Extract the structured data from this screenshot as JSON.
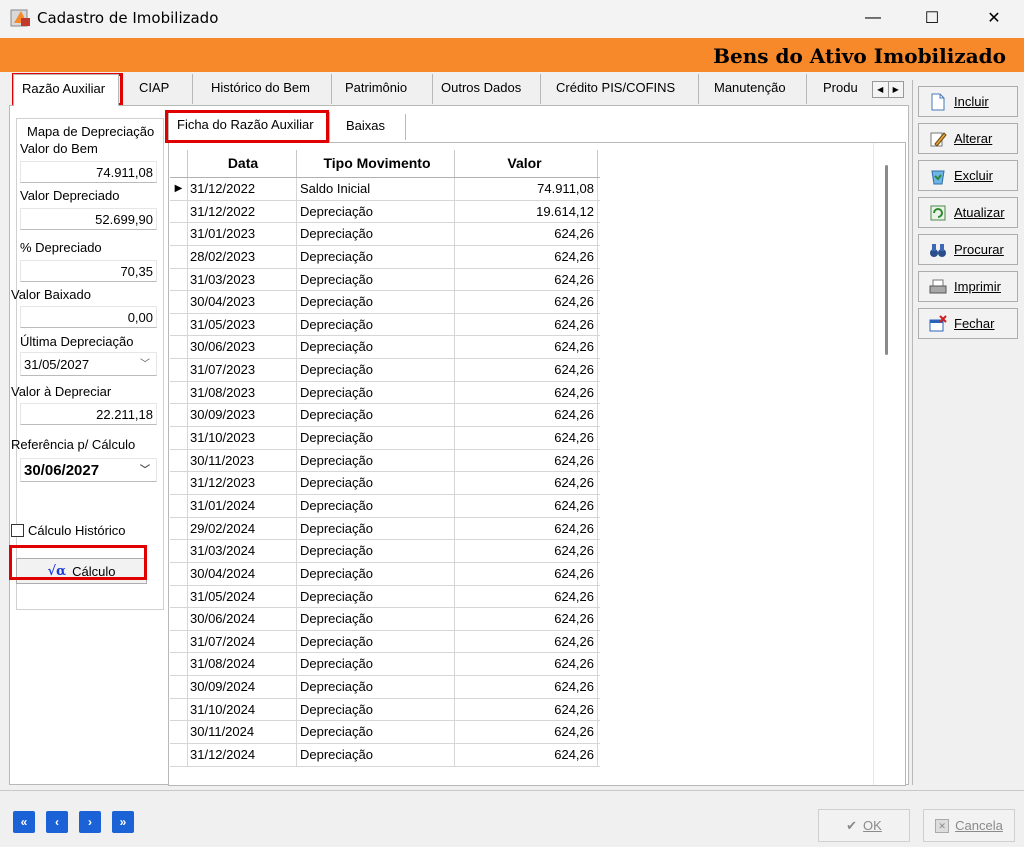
{
  "window": {
    "title": "Cadastro de Imobilizado",
    "minimize": "—",
    "maximize": "☐",
    "close": "✕"
  },
  "header": {
    "banner": "Bens do Ativo Imobilizado"
  },
  "tabs": [
    "Razão Auxiliar",
    "CIAP",
    "Histórico do Bem",
    "Patrimônio",
    "Outros Dados",
    "Crédito PIS/COFINS",
    "Manutenção",
    "Produ"
  ],
  "subtabs": [
    "Ficha do Razão Auxiliar",
    "Baixas"
  ],
  "mapa": {
    "title": "Mapa de Depreciação",
    "valor_bem_label": "Valor do Bem",
    "valor_bem": "74.911,08",
    "valor_depreciado_label": "Valor Depreciado",
    "valor_depreciado": "52.699,90",
    "pct_depreciado_label": "% Depreciado",
    "pct_depreciado": "70,35",
    "valor_baixado_label": "Valor Baixado",
    "valor_baixado": "0,00",
    "ultima_depreciacao_label": "Última Depreciação",
    "ultima_depreciacao": "31/05/2027",
    "valor_a_depreciar_label": "Valor à Depreciar",
    "valor_a_depreciar": "22.211,18",
    "referencia_label": "Referência p/ Cálculo",
    "referencia": "30/06/2027"
  },
  "calculo_historico_label": "Cálculo Histórico",
  "calculo_button": {
    "symbol": "√α",
    "label": "Cálculo"
  },
  "grid": {
    "columns": [
      "Data",
      "Tipo Movimento",
      "Valor"
    ],
    "rows": [
      [
        "31/12/2022",
        "Saldo Inicial",
        "74.911,08"
      ],
      [
        "31/12/2022",
        "Depreciação",
        "19.614,12"
      ],
      [
        "31/01/2023",
        "Depreciação",
        "624,26"
      ],
      [
        "28/02/2023",
        "Depreciação",
        "624,26"
      ],
      [
        "31/03/2023",
        "Depreciação",
        "624,26"
      ],
      [
        "30/04/2023",
        "Depreciação",
        "624,26"
      ],
      [
        "31/05/2023",
        "Depreciação",
        "624,26"
      ],
      [
        "30/06/2023",
        "Depreciação",
        "624,26"
      ],
      [
        "31/07/2023",
        "Depreciação",
        "624,26"
      ],
      [
        "31/08/2023",
        "Depreciação",
        "624,26"
      ],
      [
        "30/09/2023",
        "Depreciação",
        "624,26"
      ],
      [
        "31/10/2023",
        "Depreciação",
        "624,26"
      ],
      [
        "30/11/2023",
        "Depreciação",
        "624,26"
      ],
      [
        "31/12/2023",
        "Depreciação",
        "624,26"
      ],
      [
        "31/01/2024",
        "Depreciação",
        "624,26"
      ],
      [
        "29/02/2024",
        "Depreciação",
        "624,26"
      ],
      [
        "31/03/2024",
        "Depreciação",
        "624,26"
      ],
      [
        "30/04/2024",
        "Depreciação",
        "624,26"
      ],
      [
        "31/05/2024",
        "Depreciação",
        "624,26"
      ],
      [
        "30/06/2024",
        "Depreciação",
        "624,26"
      ],
      [
        "31/07/2024",
        "Depreciação",
        "624,26"
      ],
      [
        "31/08/2024",
        "Depreciação",
        "624,26"
      ],
      [
        "30/09/2024",
        "Depreciação",
        "624,26"
      ],
      [
        "31/10/2024",
        "Depreciação",
        "624,26"
      ],
      [
        "30/11/2024",
        "Depreciação",
        "624,26"
      ],
      [
        "31/12/2024",
        "Depreciação",
        "624,26"
      ]
    ]
  },
  "side_buttons": [
    {
      "name": "incluir-button",
      "icon": "document-icon",
      "label": "Incluir"
    },
    {
      "name": "alterar-button",
      "icon": "pencil-icon",
      "label": "Alterar"
    },
    {
      "name": "excluir-button",
      "icon": "recycle-bin-icon",
      "label": "Excluir"
    },
    {
      "name": "atualizar-button",
      "icon": "refresh-icon",
      "label": "Atualizar"
    },
    {
      "name": "procurar-button",
      "icon": "binoculars-icon",
      "label": "Procurar"
    },
    {
      "name": "imprimir-button",
      "icon": "printer-icon",
      "label": "Imprimir"
    },
    {
      "name": "fechar-button",
      "icon": "close-window-icon",
      "label": "Fechar"
    }
  ],
  "navigation": [
    "«",
    "‹",
    "›",
    "»"
  ],
  "bottom": {
    "ok_label": "OK",
    "cancela_label": "Cancela"
  },
  "colors": {
    "accent_orange": "#f7892a",
    "highlight_red": "#e10000",
    "nav_blue": "#1a62d6"
  }
}
